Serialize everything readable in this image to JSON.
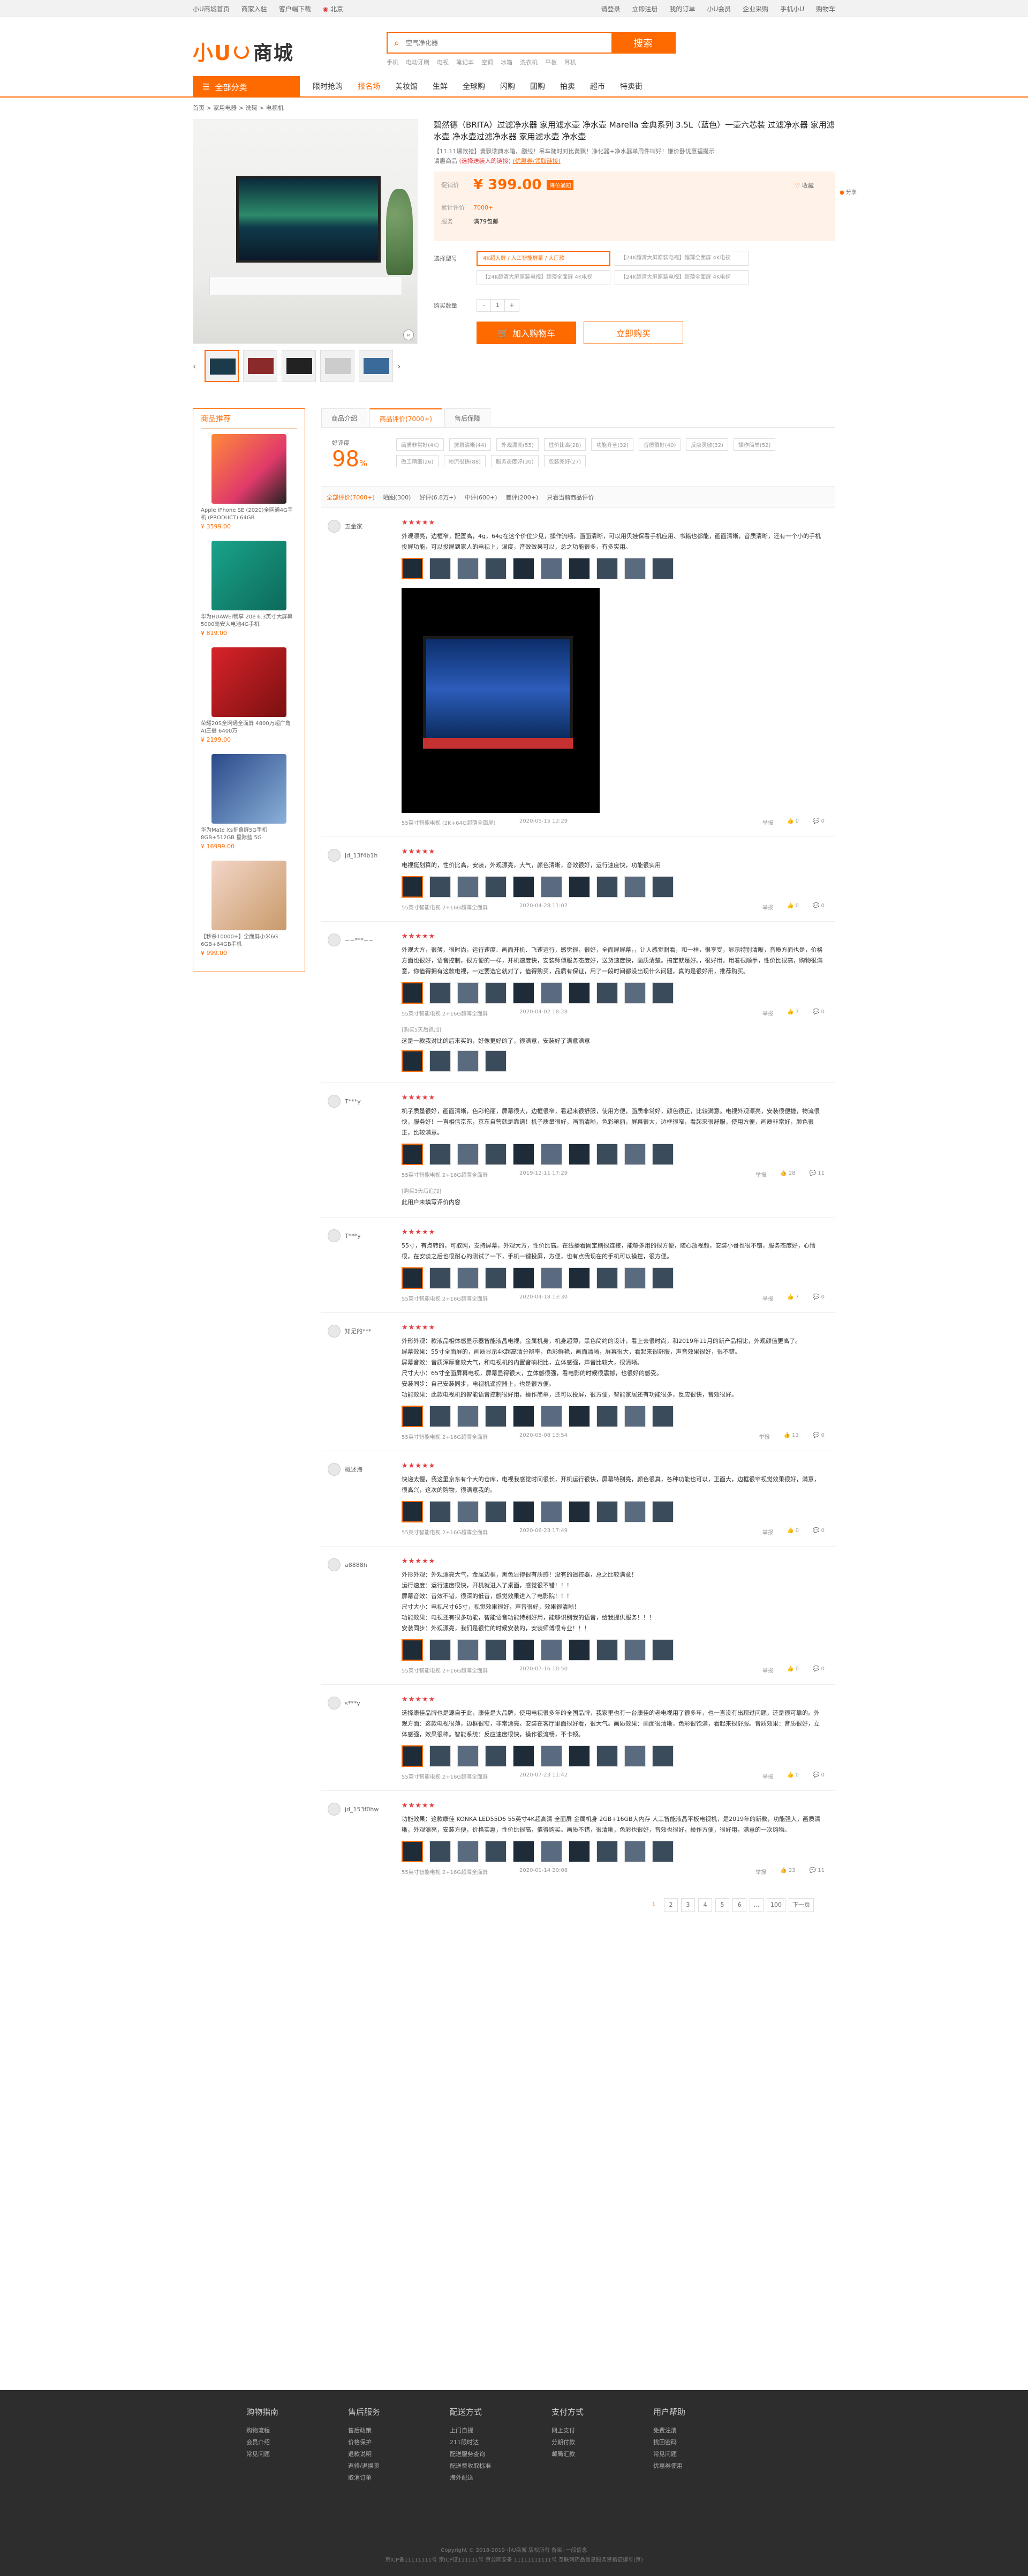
{
  "topbar": {
    "left": [
      "小U商城首页",
      "商家入驻",
      "客户端下载"
    ],
    "location": "北京",
    "right": [
      "请登录",
      "立即注册",
      "我的订单",
      "小U会员",
      "企业采购",
      "手机小U",
      "购物车"
    ]
  },
  "header": {
    "logo_text": "小U",
    "logo_cn": "商城",
    "search_placeholder": "空气净化器",
    "search_button": "搜索",
    "hotwords": [
      "手机",
      "电动牙刷",
      "电视",
      "笔记本",
      "空调",
      "冰箱",
      "洗衣机",
      "平板",
      "耳机"
    ]
  },
  "nav": {
    "all_categories": "全部分类",
    "items": [
      "限时抢购",
      "报名场",
      "美妆馆",
      "生鲜",
      "全球购",
      "闪购",
      "团购",
      "拍卖",
      "超市",
      "特卖街"
    ],
    "active_index": 1
  },
  "breadcrumb": "首页 > 家用电器 > 洗碗 > 电视机",
  "product": {
    "title": "碧然德（BRITA）过滤净水器 家用滤水壶 净水壶 Marella 金典系列 3.5L（蓝色）一壶六芯装 过滤净水器 家用滤水壶 净水壶过滤净水器 家用滤水壶 净水壶",
    "subtitle": "【11.11爆款抢】黄飘瑞典水箱，剧线！吊车随时对比黄飘！净化器+净水器单周件叫好！嫌价卧优惠福提示",
    "subtitle2": "请惠商品",
    "subtitle_red": "(选择送装入的链接)",
    "subtitle_link": "(优惠券/领取链接)",
    "price_label": "促销价",
    "price": "¥ 399.00",
    "price_tag": "降价通知",
    "promo_label": "累计评价",
    "promo_value": "7000+",
    "service_label": "服务",
    "service_value": "满79包邮",
    "collect": "收藏",
    "side_collect": "分享",
    "spec_label": "选择型号",
    "specs": [
      "4K超大屏 / 人工智能屏幕 / 大厅款",
      "【24K超清大屏原装电视】超薄全面屏 4K电视",
      "【24K超清大屏原装电视】超薄全面屏 4K电视",
      "【24K超清大屏原装电视】超薄全面屏 4K电视"
    ],
    "qty_label": "购买数量",
    "qty_minus": "-",
    "qty_value": "1",
    "qty_plus": "+",
    "add_cart": "加入购物车",
    "buy_now": "立即购买"
  },
  "recommend": {
    "title": "商品推荐",
    "items": [
      {
        "name": "Apple iPhone SE (2020)全网通4G手机 (PRODUCT) 64GB",
        "price": "¥ 3599.00"
      },
      {
        "name": "华为HUAWEI畅享 20e 6.3英寸大屏幕 5000毫安大电池4G手机",
        "price": "¥ 819.00"
      },
      {
        "name": "荣耀20S全网通全面屏 4800万超广角 AI三摄 6400万",
        "price": "¥ 2199.00"
      },
      {
        "name": "华为Mate Xs折叠屏5G手机 8GB+512GB 星际蓝 5G",
        "price": "¥ 16999.00"
      },
      {
        "name": "【秒杀10000+】全面屏小米6G 6GB+64GB手机",
        "price": "¥ 999.00"
      }
    ]
  },
  "tabs": [
    "商品介绍",
    "商品评价(7000+)",
    "售后保障"
  ],
  "score": {
    "label": "好评度",
    "value": "98",
    "unit": "%",
    "impressions": [
      "画质非常好(4K)",
      "屏幕清晰(44)",
      "外观漂亮(55)",
      "性价比高(28)",
      "功能齐全(32)",
      "音质很好(40)",
      "反应灵敏(32)",
      "操作简单(52)",
      "做工精细(26)",
      "物流很快(88)",
      "服务态度好(30)",
      "包装完好(27)"
    ]
  },
  "filters": [
    "全部评价(7000+)",
    "晒图(300)",
    "好评(6.8万+)",
    "中评(600+)",
    "差评(200+)",
    "只看当前商品评价"
  ],
  "reviews": [
    {
      "user": "五金家",
      "stars": "★★★★★",
      "text": "外观漂亮，边框窄，配置高，4g，64g在这个价位少见，操作流畅，画面清晰，可以用贝娃保看手机应用、书籍也都能，画面清晰，音质清晰，还有一个小的手机投屏功能，可以投屏到家人的电视上，温度，音效效果可以，总之功能很多，有多实用。",
      "imgs": 10,
      "video": true,
      "spec": "55英寸智能电视 (2K+64G超薄全面屏)",
      "date": "2020-05-15 12:29",
      "up": "0",
      "comment": "0"
    },
    {
      "user": "jd_13f4b1h",
      "stars": "★★★★★",
      "text": "电视挺划算的，性价比高，安装，外观漂亮，大气，颜色清晰，音效很好，运行速度快，功能很实用",
      "imgs": 10,
      "video": false,
      "spec": "55英寸智能电视 2+16G超薄全面屏",
      "date": "2020-04-28 11:02",
      "up": "0",
      "comment": "0"
    },
    {
      "user": "~~***~~",
      "stars": "★★★★★",
      "text": "外观大方，很薄，很时尚，运行速度、画面开机、飞速运行，感觉很，很好，全面屏屏幕，，让人感觉耐看，和一样，很享受，显示特别清晰，音质方面也是，价格方面也很好，语音控制，很方便的一样，开机速度快，安装师傅服务态度好，送货速度快，画质清楚。搞定就是好。，很好用。用着很顺手，性价比很高，购物很满意，你值得拥有这款电视，一定要选它就对了，值得购买，品质有保证，用了一段时间都没出现什么问题，真的是很好用，推荐购买。",
      "imgs": 10,
      "video": false,
      "spec": "55英寸智能电视 2+16G超薄全面屏",
      "date": "2020-04-02 18:28",
      "up": "7",
      "comment": "0",
      "append_label": "[购买5天后追加]",
      "append_text": "这是一款我对比的后来买的，好像更好的了，很满意，安装好了满意满意",
      "append_imgs": 4
    },
    {
      "user": "T***y",
      "stars": "★★★★★",
      "text": "机子质量很好，画面清晰，色彩艳丽，屏幕很大，边框很窄，看起来很舒服，使用方便，画质非常好，颜色很正，比较满意。电视外观漂亮，安装很便捷，物流很快，服务好！一直相信京东，京东自营就是靠谱！机子质量很好，画面清晰，色彩艳丽，屏幕很大，边框很窄，看起来很舒服，使用方便，画质非常好，颜色很正，比较满意。",
      "imgs": 10,
      "video": false,
      "spec": "55英寸智能电视 2+16G超薄全面屏",
      "date": "2019-12-11 17:29",
      "up": "28",
      "comment": "11",
      "append_label": "[购买3天后追加]",
      "append_text": "此用户未填写评价内容",
      "append_imgs": 0
    },
    {
      "user": "T***y",
      "stars": "★★★★★",
      "text": "55寸，有点转的，可取网，支持屏幕，外观大方，性价比高。在线播看固定刷很连接，能够多用的很方便，随心放视频，安装小哥也很不错，服务态度好，心情很，在安装之后也很耐心的测试了一下，手机一键投屏，方便，也有点我现在的手机可以操控，很方便。",
      "imgs": 10,
      "video": false,
      "spec": "55英寸智能电视 2+16G超薄全面屏",
      "date": "2020-04-18 13:30",
      "up": "7",
      "comment": "0"
    },
    {
      "user": "知足的***",
      "stars": "★★★★★",
      "text": "外形外观：款液品相体感显示器智能液晶电视，金属机身，机身超薄，黑色简约的设计，看上去很时尚，和2019年11月的新产品相比，外观颜值更高了。\n屏幕效果：55寸全面屏的，画质显示4K超高清分辨率，色彩鲜艳，画面清晰，屏幕很大，看起来很舒服，声音效果很好，很不错。\n屏幕音效：音质浑厚音效大气，和电视机的内置音响相比，立体感强，声音比较大，很清晰。\n尺寸大小：65寸全面屏幕电视，屏幕显得很大，立体感很强，看电影的时候很震撼，也很好的感受。\n安装同步：自己安装同步，电视机遥控器上，也是很方便。\n功能效果：此款电视机的智能语音控制很好用，操作简单，还可以投屏，很方便，智能家居还有功能很多，反应很快，音效很好。",
      "imgs": 10,
      "video": false,
      "spec": "55英寸智能电视 2+16G超薄全面屏",
      "date": "2020-05-08 13:54",
      "up": "11",
      "comment": "0"
    },
    {
      "user": "概述海",
      "stars": "★★★★★",
      "text": "快递太慢，我这里京东有个大的仓库，电视我感觉时间很长，开机运行很快，屏幕特别亮，颜色很真，各种功能也可以，正面大，边框很窄视觉效果很好，满意，很高兴，这次的购物，很满意我的。",
      "imgs": 10,
      "video": false,
      "spec": "55英寸智能电视 2+16G超薄全面屏",
      "date": "2020-06-23 17:49",
      "up": "0",
      "comment": "0"
    },
    {
      "user": "a8888h",
      "stars": "★★★★★",
      "text": "外形外观：外观漂亮大气，金属边框，黑色显得很有质感！没有的遥控器，总之比较满意！\n运行速度：运行速度很快，开机就进入了桌面，感觉很不错！！！\n屏幕音效：音效不错，很深的低音，感觉效果进入了电影院！！！\n尺寸大小：电视尺寸65寸，视觉效果很好，声音很好，效果很清晰！\n功能效果：电视还有很多功能，智能语音功能特别好用，能够识别我的语音，给我提供服务！！！\n安装同步：外观漂亮，我们是很忙的时候安装的，安装师傅很专业！！！",
      "imgs": 10,
      "video": false,
      "spec": "55英寸智能电视 2+16G超薄全面屏",
      "date": "2020-07-16 10:50",
      "up": "0",
      "comment": "0"
    },
    {
      "user": "s***y",
      "stars": "★★★★★",
      "text": "选择康佳品牌也是源自于此，康佳是大品牌，使用电视很多年的全国品牌，我家里也有一台康佳的老电视用了很多年，也一直没有出现过问题，还是很可靠的。外观方面：这款电视很薄，边框很窄，非常漂亮，安装在客厅里面很好看，很大气。画质效果：画面很清晰，色彩很饱满，看起来很舒服。音质效果：音质很好，立体感强，效果很棒。智能系统：反应速度很快，操作很流畅，不卡顿。",
      "imgs": 10,
      "video": false,
      "spec": "55英寸智能电视 2+16G超薄全面屏",
      "date": "2020-07-23 11:42",
      "up": "0",
      "comment": "0"
    },
    {
      "user": "jd_153f0hw",
      "stars": "★★★★★",
      "text": "功能效果：这款康佳 KONKA LED55D6 55英寸4K超高清 全面屏 金属机身 2GB+16GB大内存 人工智能液晶平板电视机，是2019年的新款，功能强大，画质清晰，外观漂亮，安装方便，价格实惠，性价比很高，值得购买。画质不错，很清晰，色彩也很好，音效也很好，操作方便，很好用，满意的一次购物。",
      "imgs": 10,
      "video": false,
      "spec": "55英寸智能电视 2+16G超薄全面屏",
      "date": "2020-01-14 20:08",
      "up": "23",
      "comment": "11"
    }
  ],
  "review_labels": {
    "like": "举报"
  },
  "pager": [
    "1",
    "2",
    "3",
    "4",
    "5",
    "6",
    "...",
    "100",
    "下一页"
  ],
  "footer": {
    "cols": [
      {
        "title": "购物指南",
        "items": [
          "购物流程",
          "会员介绍",
          "常见问题"
        ]
      },
      {
        "title": "售后服务",
        "items": [
          "售后政策",
          "价格保护",
          "退款说明",
          "返修/退换货",
          "取消订单"
        ]
      },
      {
        "title": "配送方式",
        "items": [
          "上门自提",
          "211限时达",
          "配送服务查询",
          "配送费收取标准",
          "海外配送"
        ]
      },
      {
        "title": "支付方式",
        "items": [
          "网上支付",
          "分期付款",
          "邮局汇款"
        ]
      },
      {
        "title": "用户帮助",
        "items": [
          "免费注册",
          "找回密码",
          "常见问题",
          "优惠券使用"
        ]
      }
    ],
    "copy1": "Copyright © 2018-2019 小U商城 版权所有 备案: 一般信息",
    "copy2": "京ICP备11111111号 京ICP证111111号 京公网安备 11111111111号 互联网药品信息服务资格证编号(京)"
  }
}
